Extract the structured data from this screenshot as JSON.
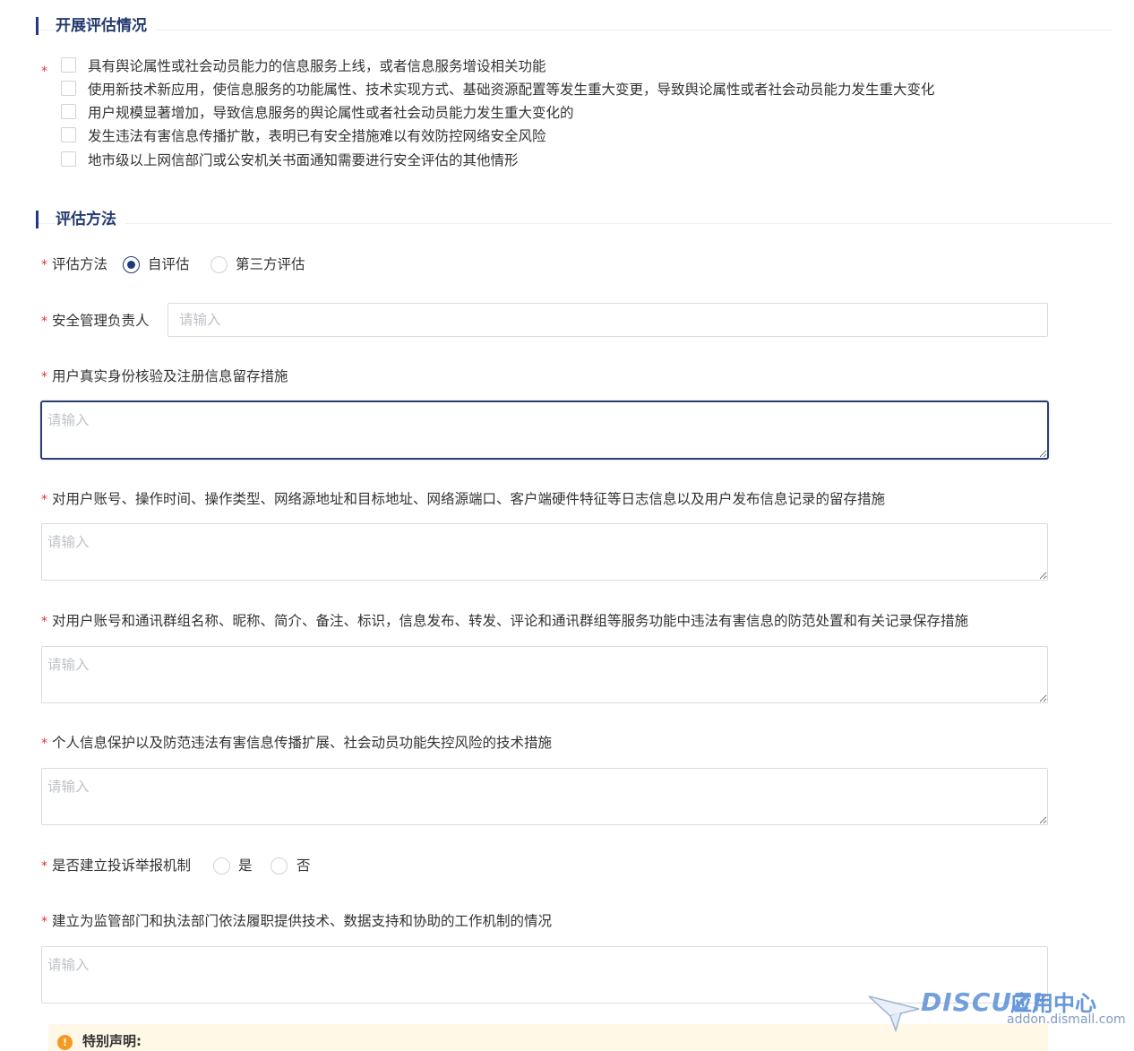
{
  "sections": {
    "situation_title": "开展评估情况",
    "method_title": "评估方法"
  },
  "situation": {
    "required_mark": "*",
    "options": [
      "具有舆论属性或社会动员能力的信息服务上线，或者信息服务增设相关功能",
      "使用新技术新应用，使信息服务的功能属性、技术实现方式、基础资源配置等发生重大变更，导致舆论属性或者社会动员能力发生重大变化",
      "用户规模显著增加，导致信息服务的舆论属性或者社会动员能力发生重大变化的",
      "发生违法有害信息传播扩散，表明已有安全措施难以有效防控网络安全风险",
      "地市级以上网信部门或公安机关书面通知需要进行安全评估的其他情形"
    ]
  },
  "method": {
    "label": "评估方法",
    "options": [
      "自评估",
      "第三方评估"
    ],
    "selected": "自评估"
  },
  "manager": {
    "label": "安全管理负责人",
    "placeholder": "请输入",
    "value": ""
  },
  "fields": {
    "identity_label": "用户真实身份核验及注册信息留存措施",
    "log_label": "对用户账号、操作时间、操作类型、网络源地址和目标地址、网络源端口、客户端硬件特征等日志信息以及用户发布信息记录的留存措施",
    "prevention_label": "对用户账号和通讯群组名称、昵称、简介、备注、标识，信息发布、转发、评论和通讯群组等服务功能中违法有害信息的防范处置和有关记录保存措施",
    "tech_label": "个人信息保护以及防范违法有害信息传播扩展、社会动员功能失控风险的技术措施",
    "mechanism_label": "建立为监管部门和执法部门依法履职提供技术、数据支持和协助的工作机制的情况",
    "placeholder": "请输入"
  },
  "complaint": {
    "label": "是否建立投诉举报机制",
    "options": [
      "是",
      "否"
    ]
  },
  "notice": {
    "title": "特别声明:"
  },
  "watermark": {
    "text": "DISCUZ!",
    "cn": "应用中心",
    "url": "addon.dismall.com"
  },
  "required_mark": "*"
}
